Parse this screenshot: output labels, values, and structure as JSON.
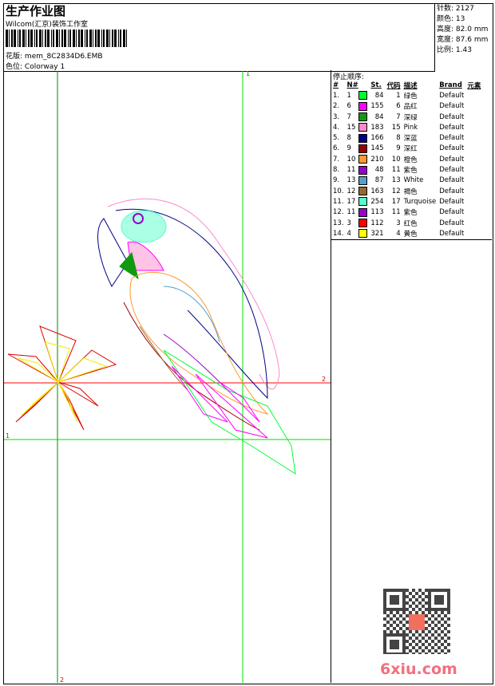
{
  "header": {
    "title": "生产作业图",
    "company": "Wilcom(汇京)装饰工作室",
    "design_label": "花版:",
    "design_file": "mem_8C2834D6.EMB",
    "colorway_label": "色位:",
    "colorway": "Colorway 1"
  },
  "stats": [
    {
      "label": "针数:",
      "value": "2127"
    },
    {
      "label": "颜色:",
      "value": "13"
    },
    {
      "label": "高度:",
      "value": "82.0 mm"
    },
    {
      "label": "宽度:",
      "value": "87.6 mm"
    },
    {
      "label": "比例:",
      "value": "1.43"
    }
  ],
  "stop_sequence": {
    "title": "停止顺序:",
    "columns": [
      "#",
      "N#",
      "St.",
      "代码",
      "描述",
      "Brand",
      "元素"
    ],
    "rows": [
      {
        "idx": "1.",
        "n": "1",
        "color": "#00ff33",
        "st": "84",
        "code": "1",
        "desc": "绿色",
        "brand": "Default"
      },
      {
        "idx": "2.",
        "n": "6",
        "color": "#ff00ff",
        "st": "155",
        "code": "6",
        "desc": "品红",
        "brand": "Default"
      },
      {
        "idx": "3.",
        "n": "7",
        "color": "#119911",
        "st": "84",
        "code": "7",
        "desc": "深绿",
        "brand": "Default"
      },
      {
        "idx": "4.",
        "n": "15",
        "color": "#ff88cc",
        "st": "183",
        "code": "15",
        "desc": "Pink",
        "brand": "Default"
      },
      {
        "idx": "5.",
        "n": "8",
        "color": "#000088",
        "st": "166",
        "code": "8",
        "desc": "深蓝",
        "brand": "Default"
      },
      {
        "idx": "6.",
        "n": "9",
        "color": "#990000",
        "st": "145",
        "code": "9",
        "desc": "深红",
        "brand": "Default"
      },
      {
        "idx": "7.",
        "n": "10",
        "color": "#ff9933",
        "st": "210",
        "code": "10",
        "desc": "橙色",
        "brand": "Default"
      },
      {
        "idx": "8.",
        "n": "11",
        "color": "#9900cc",
        "st": "48",
        "code": "11",
        "desc": "紫色",
        "brand": "Default"
      },
      {
        "idx": "9.",
        "n": "13",
        "color": "#55a0cc",
        "st": "87",
        "code": "13",
        "desc": "White",
        "brand": "Default"
      },
      {
        "idx": "10.",
        "n": "12",
        "color": "#996633",
        "st": "163",
        "code": "12",
        "desc": "褐色",
        "brand": "Default"
      },
      {
        "idx": "11.",
        "n": "17",
        "color": "#55ffcc",
        "st": "254",
        "code": "17",
        "desc": "Turquoise",
        "brand": "Default"
      },
      {
        "idx": "12.",
        "n": "11",
        "color": "#9900cc",
        "st": "113",
        "code": "11",
        "desc": "紫色",
        "brand": "Default"
      },
      {
        "idx": "13.",
        "n": "3",
        "color": "#ff0000",
        "st": "112",
        "code": "3",
        "desc": "红色",
        "brand": "Default"
      },
      {
        "idx": "14.",
        "n": "4",
        "color": "#ffff00",
        "st": "321",
        "code": "4",
        "desc": "黄色",
        "brand": "Default"
      }
    ]
  },
  "guides": {
    "top": "1",
    "right": "2",
    "left": "1",
    "bottom": "2"
  },
  "watermark": {
    "logo": "6xiu.com",
    "seal": "汇京制版"
  }
}
